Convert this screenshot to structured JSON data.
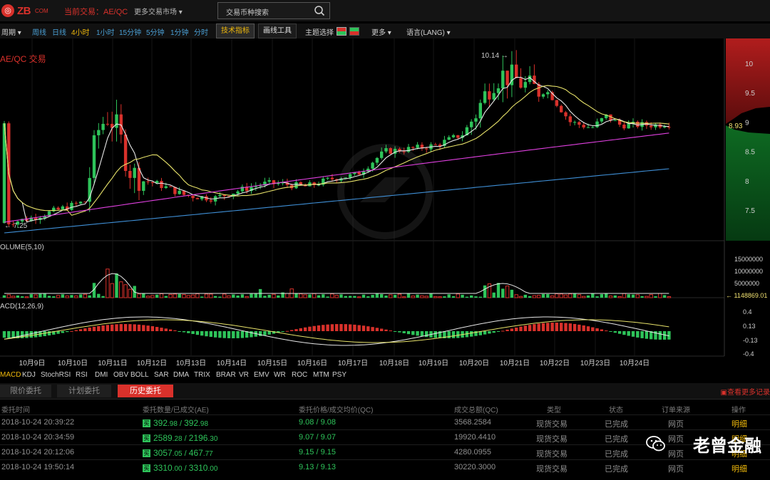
{
  "header": {
    "logo_text": "ZB",
    "logo_sub": "COM",
    "current_pair_label": "当前交易：AE/QC",
    "more_markets": "更多交易市场 ▾",
    "search_placeholder": "交易币种搜索"
  },
  "toolbar": {
    "period_menu": "周期 ▾",
    "periods": [
      "周线",
      "日线",
      "4小时",
      "1小时",
      "15分钟",
      "5分钟",
      "1分钟",
      "分时"
    ],
    "selected_period": "4小时",
    "tech_indicators": "技术指标",
    "drawing_tools": "画线工具",
    "theme_select": "主题选择",
    "more": "更多 ▾",
    "language": "语言(LANG) ▾"
  },
  "chart": {
    "pair_title": "AE/QC 交易",
    "high_label": "10.14",
    "low_label": "7.25",
    "last_price": "8.93",
    "price_ticks": [
      "10",
      "9.5",
      "9",
      "8.5",
      "8",
      "7.5"
    ],
    "volume_label": "OLUME(5,10)",
    "volume_ticks": [
      "15000000",
      "10000000",
      "5000000"
    ],
    "volume_last": "1148869.01",
    "macd_label": "ACD(12,26,9)",
    "macd_ticks": [
      "0.4",
      "0.13",
      "-0.13",
      "-0.4"
    ],
    "dates": [
      "10月9日",
      "10月10日",
      "10月11日",
      "10月12日",
      "10月13日",
      "10月14日",
      "10月15日",
      "10月16日",
      "10月17日",
      "10月18日",
      "10月19日",
      "10月20日",
      "10月21日",
      "10月22日",
      "10月23日",
      "10月24日"
    ],
    "colors": {
      "up": "#2ec45a",
      "down": "#d9312b",
      "ma5": "#e8e8e8",
      "ma10": "#e8e36a",
      "ma30": "#e040e0",
      "ma60": "#3f8fd6"
    }
  },
  "indicators": [
    "MACD",
    "KDJ",
    "StochRSI",
    "RSI",
    "DMI",
    "OBV",
    "BOLL",
    "SAR",
    "DMA",
    "TRIX",
    "BRAR",
    "VR",
    "EMV",
    "WR",
    "ROC",
    "MTM",
    "PSY"
  ],
  "active_indicator": "MACD",
  "orders": {
    "tabs": [
      "限价委托",
      "计划委托",
      "历史委托"
    ],
    "active_tab": "历史委托",
    "more_records": "查看更多记录",
    "columns": [
      "委托时间",
      "委托数量/已成交(AE)",
      "委托价格/成交均价(QC)",
      "成交总额(QC)",
      "类型",
      "状态",
      "订单来源",
      "操作"
    ],
    "rows": [
      {
        "time": "2018-10-24 20:39:22",
        "qty_int": "392",
        "qty_dec": ".98",
        "filled_int": "392",
        "filled_dec": ".98",
        "price": "9.08 / 9.08",
        "total": "3568.2584",
        "type": "现货交易",
        "status": "已完成",
        "source": "网页",
        "action": "明细"
      },
      {
        "time": "2018-10-24 20:34:59",
        "qty_int": "2589",
        "qty_dec": ".28",
        "filled_int": "2196",
        "filled_dec": ".30",
        "price": "9.07 / 9.07",
        "total": "19920.4410",
        "type": "现货交易",
        "status": "已完成",
        "source": "网页",
        "action": "明细"
      },
      {
        "time": "2018-10-24 20:12:06",
        "qty_int": "3057",
        "qty_dec": ".05",
        "filled_int": "467",
        "filled_dec": ".77",
        "price": "9.15 / 9.15",
        "total": "4280.0955",
        "type": "现货交易",
        "status": "已完成",
        "source": "网页",
        "action": "明细"
      },
      {
        "time": "2018-10-24 19:50:14",
        "qty_int": "3310",
        "qty_dec": ".00",
        "filled_int": "3310",
        "filled_dec": ".00",
        "price": "9.13 / 9.13",
        "total": "30220.3000",
        "type": "现货交易",
        "status": "已完成",
        "source": "网页",
        "action": "明细"
      }
    ],
    "qty_badge": "买"
  },
  "watermark": {
    "text": "老曾金融"
  }
}
